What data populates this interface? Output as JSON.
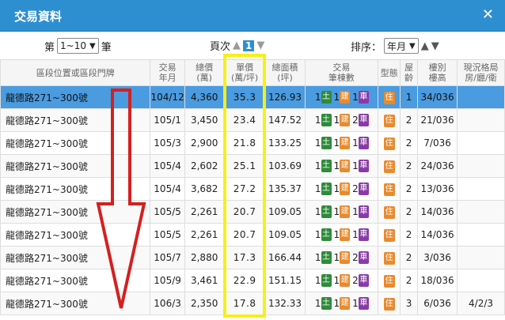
{
  "title": "交易資料",
  "controls": {
    "page_prefix": "第",
    "page_range": "1~10",
    "page_suffix": "筆",
    "page_label": "頁次",
    "current_page": "1",
    "sort_label": "排序：",
    "sort_value": "年月"
  },
  "table": {
    "headers": {
      "location": "區段位置或區段門牌",
      "date": [
        "交易",
        "年月"
      ],
      "total": [
        "總價",
        "(萬)"
      ],
      "unit": [
        "單價",
        "(萬/坪)"
      ],
      "area": [
        "總面積",
        "(坪)"
      ],
      "units": [
        "交易",
        "筆棟數"
      ],
      "type": "型態",
      "age": [
        "屋",
        "齡"
      ],
      "floor": [
        "樓別",
        "樓高"
      ],
      "layout": [
        "現況格局",
        "房/廳/衛"
      ]
    },
    "unit_labels": {
      "land": "土",
      "building": "建",
      "parking": "車"
    },
    "type_label": "住",
    "rows": [
      {
        "location": "龍德路271~300號",
        "date": "104/12",
        "total": "4,360",
        "unit": "35.3",
        "area": "126.93",
        "land": "1",
        "building": "1",
        "parking": "1",
        "age": "1",
        "floor": "34/036",
        "layout": ""
      },
      {
        "location": "龍德路271~300號",
        "date": "105/1",
        "total": "3,450",
        "unit": "23.4",
        "area": "147.52",
        "land": "1",
        "building": "1",
        "parking": "2",
        "age": "2",
        "floor": "21/036",
        "layout": ""
      },
      {
        "location": "龍德路271~300號",
        "date": "105/3",
        "total": "2,900",
        "unit": "21.8",
        "area": "133.25",
        "land": "1",
        "building": "1",
        "parking": "1",
        "age": "2",
        "floor": "7/036",
        "layout": ""
      },
      {
        "location": "龍德路271~300號",
        "date": "105/4",
        "total": "2,602",
        "unit": "25.1",
        "area": "103.69",
        "land": "1",
        "building": "1",
        "parking": "1",
        "age": "2",
        "floor": "24/036",
        "layout": ""
      },
      {
        "location": "龍德路271~300號",
        "date": "105/4",
        "total": "3,682",
        "unit": "27.2",
        "area": "135.37",
        "land": "1",
        "building": "1",
        "parking": "2",
        "age": "2",
        "floor": "13/036",
        "layout": ""
      },
      {
        "location": "龍德路271~300號",
        "date": "105/5",
        "total": "2,261",
        "unit": "20.7",
        "area": "109.05",
        "land": "1",
        "building": "1",
        "parking": "1",
        "age": "2",
        "floor": "14/036",
        "layout": ""
      },
      {
        "location": "龍德路271~300號",
        "date": "105/5",
        "total": "2,261",
        "unit": "20.7",
        "area": "109.05",
        "land": "1",
        "building": "1",
        "parking": "1",
        "age": "2",
        "floor": "14/036",
        "layout": ""
      },
      {
        "location": "龍德路271~300號",
        "date": "105/7",
        "total": "2,880",
        "unit": "17.3",
        "area": "166.44",
        "land": "1",
        "building": "1",
        "parking": "2",
        "age": "2",
        "floor": "3/036",
        "layout": ""
      },
      {
        "location": "龍德路271~300號",
        "date": "105/9",
        "total": "3,461",
        "unit": "22.9",
        "area": "151.15",
        "land": "1",
        "building": "1",
        "parking": "2",
        "age": "2",
        "floor": "18/036",
        "layout": ""
      },
      {
        "location": "龍德路271~300號",
        "date": "106/3",
        "total": "2,350",
        "unit": "17.8",
        "area": "132.33",
        "land": "1",
        "building": "1",
        "parking": "1",
        "age": "3",
        "floor": "6/036",
        "layout": "4/2/3"
      }
    ]
  },
  "colors": {
    "header_blue": "#2e8fd0",
    "highlight_yellow": "#f5f01a",
    "arrow_red": "#d42020"
  }
}
